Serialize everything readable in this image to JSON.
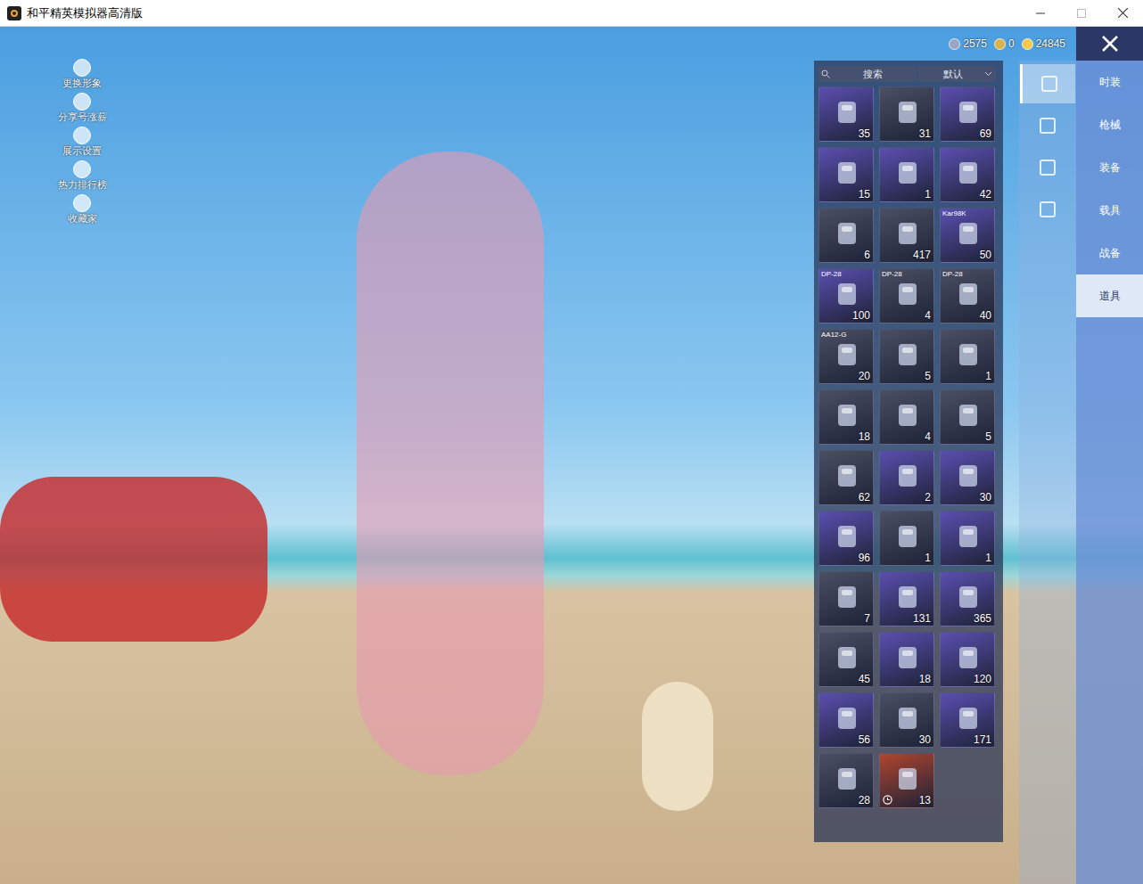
{
  "window": {
    "title": "和平精英模拟器高清版"
  },
  "side_menu": [
    {
      "label": "更换形象"
    },
    {
      "label": "分享号涨薪"
    },
    {
      "label": "展示设置"
    },
    {
      "label": "热力排行榜"
    },
    {
      "label": "收藏家"
    }
  ],
  "currency": [
    {
      "amount": "2575",
      "color": "#9aa6c8"
    },
    {
      "amount": "0",
      "color": "#d9b24a"
    },
    {
      "amount": "24845",
      "color": "#f2c94c"
    }
  ],
  "search": {
    "placeholder": "搜索",
    "sort": "默认"
  },
  "icon_tabs": [
    {
      "selected": true
    },
    {
      "selected": false
    },
    {
      "selected": false
    },
    {
      "selected": false
    }
  ],
  "categories": [
    {
      "label": "时装",
      "selected": false
    },
    {
      "label": "枪械",
      "selected": false
    },
    {
      "label": "装备",
      "selected": false
    },
    {
      "label": "载具",
      "selected": false
    },
    {
      "label": "战备",
      "selected": false
    },
    {
      "label": "道具",
      "selected": true
    }
  ],
  "items": [
    {
      "label": "",
      "count": "35",
      "color": "#5a4fb0",
      "timed": false
    },
    {
      "label": "",
      "count": "31",
      "color": "#4b4f63",
      "timed": false
    },
    {
      "label": "",
      "count": "69",
      "color": "#5a4fb0",
      "timed": false
    },
    {
      "label": "",
      "count": "15",
      "color": "#5a4fb0",
      "timed": false
    },
    {
      "label": "",
      "count": "1",
      "color": "#5a4fb0",
      "timed": false
    },
    {
      "label": "",
      "count": "42",
      "color": "#5a4fb0",
      "timed": false
    },
    {
      "label": "",
      "count": "6",
      "color": "#4b4f63",
      "timed": false
    },
    {
      "label": "",
      "count": "417",
      "color": "#4b4f63",
      "timed": false
    },
    {
      "label": "Kar98K",
      "count": "50",
      "color": "#5a4fb0",
      "timed": false
    },
    {
      "label": "DP-28",
      "count": "100",
      "color": "#5a4fb0",
      "timed": false
    },
    {
      "label": "DP-28",
      "count": "4",
      "color": "#4b4f63",
      "timed": false
    },
    {
      "label": "DP-28",
      "count": "40",
      "color": "#4b4f63",
      "timed": false
    },
    {
      "label": "AA12-G",
      "count": "20",
      "color": "#4b4f63",
      "timed": false
    },
    {
      "label": "",
      "count": "5",
      "color": "#4b4f63",
      "timed": false
    },
    {
      "label": "",
      "count": "1",
      "color": "#4b4f63",
      "timed": false
    },
    {
      "label": "",
      "count": "18",
      "color": "#4b4f63",
      "timed": false
    },
    {
      "label": "",
      "count": "4",
      "color": "#4b4f63",
      "timed": false
    },
    {
      "label": "",
      "count": "5",
      "color": "#4b4f63",
      "timed": false
    },
    {
      "label": "",
      "count": "62",
      "color": "#4b4f63",
      "timed": false
    },
    {
      "label": "",
      "count": "2",
      "color": "#5a4fb0",
      "timed": false
    },
    {
      "label": "",
      "count": "30",
      "color": "#5a4fb0",
      "timed": false
    },
    {
      "label": "",
      "count": "96",
      "color": "#5a4fb0",
      "timed": false
    },
    {
      "label": "",
      "count": "1",
      "color": "#4b4f63",
      "timed": false
    },
    {
      "label": "",
      "count": "1",
      "color": "#5a4fb0",
      "timed": false
    },
    {
      "label": "",
      "count": "7",
      "color": "#4b4f63",
      "timed": false
    },
    {
      "label": "",
      "count": "131",
      "color": "#5a4fb0",
      "timed": false
    },
    {
      "label": "",
      "count": "365",
      "color": "#5a4fb0",
      "timed": false
    },
    {
      "label": "",
      "count": "45",
      "color": "#4b4f63",
      "timed": false
    },
    {
      "label": "",
      "count": "18",
      "color": "#5a4fb0",
      "timed": false
    },
    {
      "label": "",
      "count": "120",
      "color": "#5a4fb0",
      "timed": false
    },
    {
      "label": "",
      "count": "56",
      "color": "#5a4fb0",
      "timed": false
    },
    {
      "label": "",
      "count": "30",
      "color": "#4b4f63",
      "timed": false
    },
    {
      "label": "",
      "count": "171",
      "color": "#5a4fb0",
      "timed": false
    },
    {
      "label": "",
      "count": "28",
      "color": "#4b4f63",
      "timed": false
    },
    {
      "label": "",
      "count": "13",
      "color": "#b0452f",
      "timed": true
    }
  ]
}
